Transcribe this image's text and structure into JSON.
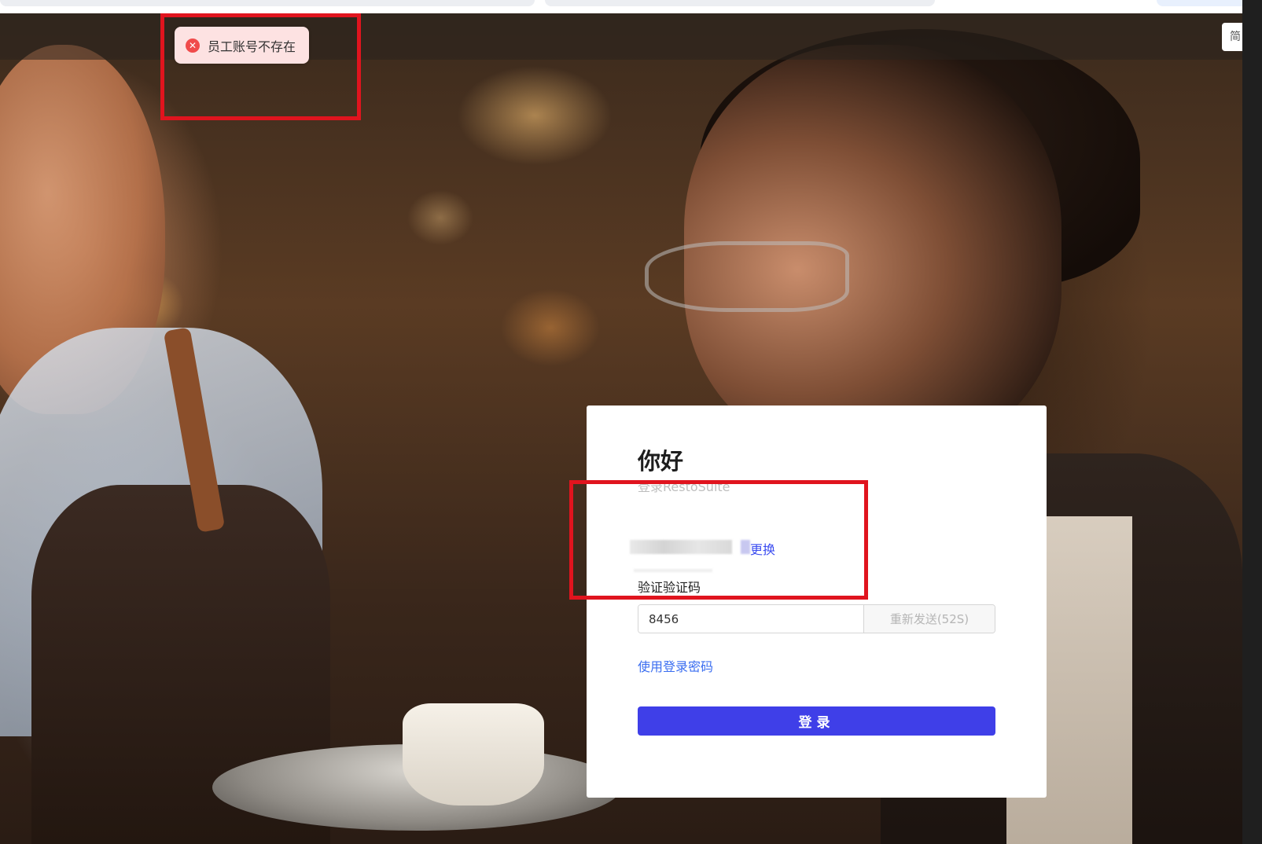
{
  "toast": {
    "icon": "error-circle-icon",
    "message": "员工账号不存在",
    "color": "#f04b4b"
  },
  "corner": {
    "label": "简"
  },
  "login": {
    "greeting": "你好",
    "subtitle": "登录RestoSuite",
    "change_link": "更换",
    "code_label": "验证验证码",
    "code_value": "8456",
    "resend_label": "重新发送(52S)",
    "use_password_link": "使用登录密码",
    "submit_label": "登录"
  },
  "colors": {
    "primary": "#3f3fe8",
    "link": "#3b6ef0",
    "annotation": "#e0141e"
  }
}
